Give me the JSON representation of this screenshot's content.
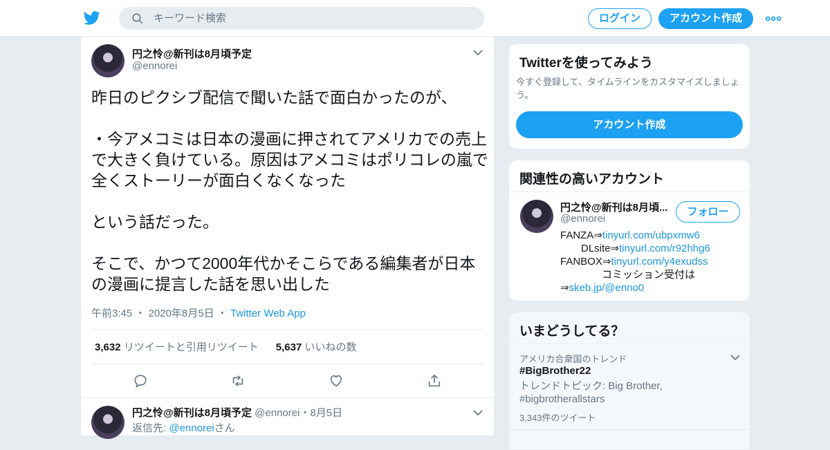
{
  "header": {
    "search_placeholder": "キーワード検索",
    "login_label": "ログイン",
    "signup_label": "アカウント作成",
    "accent_color": "#1da1f2"
  },
  "tweet": {
    "display_name": "円之怜@新刊は8月頃予定",
    "handle": "@ennorei",
    "text": "昨日のピクシブ配信で聞いた話で面白かったのが、\n\n・今アメコミは日本の漫画に押されてアメリカでの売上で大きく負けている。原因はアメコミはポリコレの嵐で全くストーリーが面白くなくなった\n\nという話だった。\n\nそこで、かつて2000年代かそこらである編集者が日本の漫画に提言した話を思い出した",
    "time": "午前3:45",
    "date": "2020年8月5日",
    "separator": "・",
    "source": "Twitter Web App",
    "retweet_count": "3,632",
    "retweet_label": "リツイートと引用リツイート",
    "like_count": "5,637",
    "like_label": "いいねの数"
  },
  "reply": {
    "display_name": "円之怜@新刊は8月頃予定",
    "handle": "@ennorei",
    "separator": "・",
    "date": "8月5日",
    "reply_to_label": "返信先:",
    "reply_to_handle": "@ennorei",
    "reply_to_suffix": "さん"
  },
  "sidebar": {
    "signup_card": {
      "title": "Twitterを使ってみよう",
      "subtitle": "今すぐ登録して、タイムラインをカスタマイズしましょう。",
      "button_label": "アカウント作成"
    },
    "related": {
      "title": "関連性の高いアカウント",
      "display_name": "円之怜@新刊は8月頃...",
      "handle": "@ennorei",
      "follow_label": "フォロー",
      "bio_line1_text": "FANZA⇒",
      "bio_line1_link": "tinyurl.com/ubpxmw6",
      "bio_line2_text": "DLsite⇒",
      "bio_line2_link": "tinyurl.com/r92hhg6",
      "bio_line3_text": "FANBOX⇒",
      "bio_line3_link": "tinyurl.com/y4exudss",
      "bio_line4_text": "コミッション受付は",
      "bio_line5_text": "⇒",
      "bio_line5_link": "skeb.jp/@enno0"
    },
    "trends": {
      "title": "いまどうしてる？",
      "location_label": "アメリカ合衆国のトレンド",
      "tag": "#BigBrother22",
      "description": "トレンドトピック: Big Brother, #bigbrotherallstars",
      "count": "3,343件のツイート"
    }
  }
}
